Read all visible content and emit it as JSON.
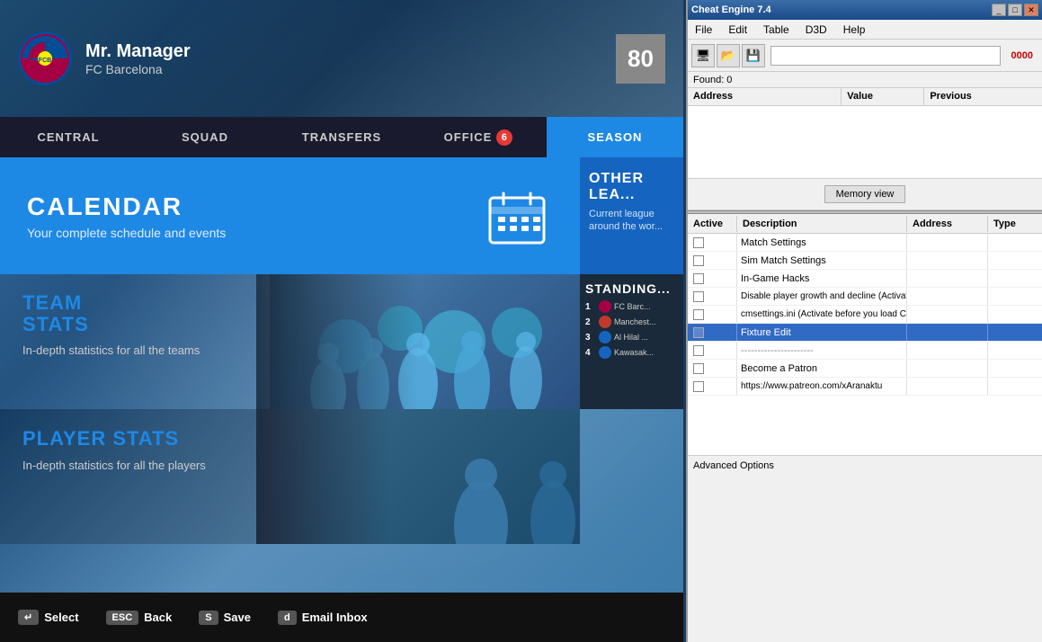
{
  "game": {
    "manager_name": "Mr. Manager",
    "club_name": "FC Barcelona",
    "rating": "80",
    "nav_tabs": [
      {
        "id": "central",
        "label": "CENTRAL",
        "active": false,
        "badge": null
      },
      {
        "id": "squad",
        "label": "SQUAD",
        "active": false,
        "badge": null
      },
      {
        "id": "transfers",
        "label": "TRANSFERS",
        "active": false,
        "badge": null
      },
      {
        "id": "office",
        "label": "OFFICE",
        "active": false,
        "badge": "6"
      },
      {
        "id": "season",
        "label": "SEASON",
        "active": true,
        "badge": null
      }
    ],
    "calendar": {
      "title": "CALENDAR",
      "subtitle": "Your complete schedule and events"
    },
    "other_leagues": {
      "title": "OTHER LEA...",
      "text": "Current league around the wor..."
    },
    "team_stats": {
      "title": "TEAM\nSTATS",
      "subtitle": "In-depth statistics for all the teams"
    },
    "standings": {
      "title": "STANDING...",
      "rows": [
        {
          "num": "1",
          "name": "FC Barc..."
        },
        {
          "num": "2",
          "name": "Manchest..."
        },
        {
          "num": "3",
          "name": "Al Hilal ..."
        },
        {
          "num": "4",
          "name": "Kawasak..."
        }
      ]
    },
    "player_stats": {
      "title": "PLAYER STATS",
      "subtitle": "In-depth statistics for all the players"
    },
    "bottom_actions": [
      {
        "key": "↵",
        "label": "Select"
      },
      {
        "key": "ESC",
        "label": "Back"
      },
      {
        "key": "S",
        "label": "Save"
      },
      {
        "key": "d",
        "label": "Email Inbox"
      }
    ]
  },
  "cheat_engine": {
    "title": "Cheat Engine 7.4",
    "menu": [
      "File",
      "Edit",
      "Table",
      "D3D",
      "Help"
    ],
    "toolbar_icons": [
      "screen",
      "floppy",
      "save"
    ],
    "found_label": "Found: 0",
    "value_display": "0000",
    "table_headers": [
      "Address",
      "Value",
      "Previous"
    ],
    "memory_view_btn": "Memory view",
    "bottom_headers": [
      "Active",
      "Description",
      "Address",
      "Type"
    ],
    "rows": [
      {
        "checked": false,
        "desc": "Match Settings",
        "addr": "",
        "type": "",
        "selected": false,
        "separator": false
      },
      {
        "checked": false,
        "desc": "Sim Match Settings",
        "addr": "",
        "type": "",
        "selected": false,
        "separator": false
      },
      {
        "checked": false,
        "desc": "In-Game Hacks",
        "addr": "",
        "type": "",
        "selected": false,
        "separator": false
      },
      {
        "checked": false,
        "desc": "Disable player growth and decline (Activate before you load Caree...",
        "addr": "",
        "type": "",
        "selected": false,
        "separator": false
      },
      {
        "checked": false,
        "desc": "cmsettings.ini (Activate before you load Career Save)",
        "addr": "",
        "type": "",
        "selected": false,
        "separator": false
      },
      {
        "checked": false,
        "desc": "Fixture Edit",
        "addr": "",
        "type": "",
        "selected": true,
        "separator": false
      },
      {
        "checked": false,
        "desc": "----------------------",
        "addr": "",
        "type": "",
        "selected": false,
        "separator": true
      },
      {
        "checked": false,
        "desc": "Become a Patron",
        "addr": "",
        "type": "",
        "selected": false,
        "separator": false
      },
      {
        "checked": false,
        "desc": "https://www.patreon.com/xAranaktu",
        "addr": "",
        "type": "",
        "selected": false,
        "separator": false
      }
    ],
    "footer_text": "Advanced Options"
  }
}
